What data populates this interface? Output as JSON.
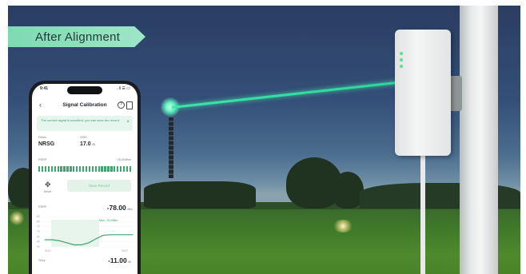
{
  "banner": {
    "label": "After Alignment"
  },
  "colors": {
    "banner": "#8fe0bf",
    "beam": "#3de6a8",
    "signal_bar": "#3ea56c"
  },
  "phone": {
    "status": {
      "time": "9:41",
      "icons": "..ll ☰ ▭"
    },
    "nav": {
      "back_icon": "chevron-left-icon",
      "title": "Signal Calibration",
      "help_icon": "help-circle-icon",
      "record_icon": "document-icon"
    },
    "alert": {
      "text": "The current signal is excellent, you can save the record.",
      "close_icon": "close-icon"
    },
    "radio": {
      "label": "Radio",
      "value": "NRSG"
    },
    "ssid": {
      "label": "SSID",
      "value": "17.0",
      "unit": "dB"
    },
    "rsrp_meter": {
      "label": "RSRP",
      "value": "~78.00dBm",
      "bars": 30
    },
    "mode": {
      "icon": "crosshair-icon",
      "label": "Mode"
    },
    "save_button": "Save Record",
    "rsrp": {
      "label": "RSRP",
      "value": "-78.00",
      "unit": "dBm"
    },
    "chart": {
      "y_ticks": [
        "-60",
        "-65",
        "-70",
        "-75",
        "-80",
        "-85",
        "-90"
      ],
      "annotation": "Max:-78.0dBm",
      "x_start": "00:01",
      "x_end": "00:07"
    },
    "sinr": {
      "label": "Sinry",
      "value": "-11.00",
      "unit": "dB"
    }
  },
  "chart_data": {
    "type": "line",
    "ylim": [
      -90,
      -60
    ],
    "x": [
      0,
      1,
      2,
      3,
      4,
      5,
      6,
      7,
      8,
      9,
      10,
      11,
      12
    ],
    "series": [
      {
        "values": [
          -83,
          -83,
          -84,
          -86,
          -88,
          -88,
          -86,
          -82,
          -78.5,
          -78,
          -78,
          -78,
          -78
        ]
      }
    ]
  }
}
